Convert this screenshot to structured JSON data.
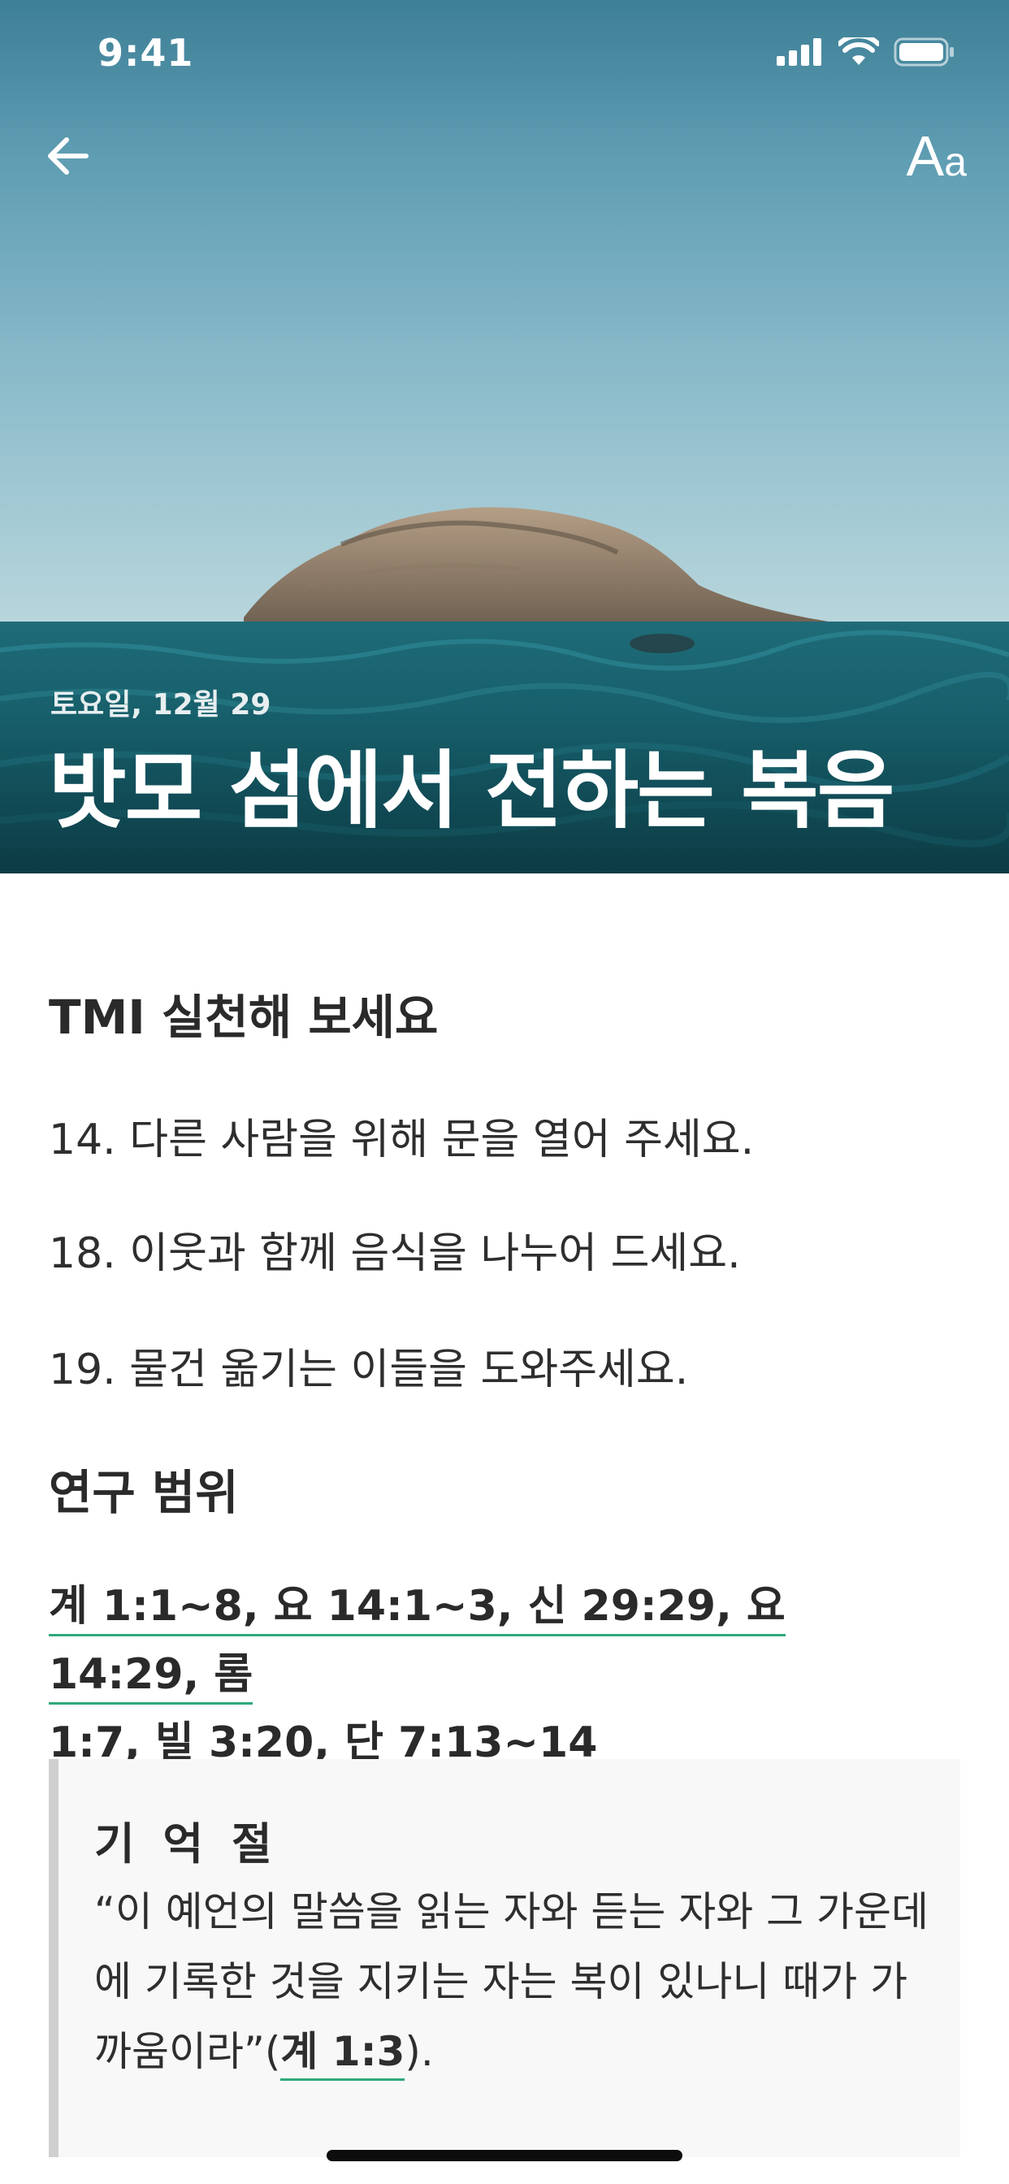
{
  "status_bar": {
    "time": "9:41",
    "icons": [
      "signal-icon",
      "wifi-icon",
      "battery-icon"
    ]
  },
  "nav": {
    "back_icon": "arrow-left-icon",
    "font_size_label_big": "A",
    "font_size_label_small": "a"
  },
  "hero": {
    "date": "토요일, 12월 29",
    "title": "밧모 섬에서 전하는 복음"
  },
  "tmi": {
    "heading": "TMI 실천해 보세요",
    "items": [
      "14. 다른 사람을 위해 문을 열어 주세요.",
      "18. 이웃과 함께 음식을 나누어 드세요.",
      "19. 물건 옮기는 이들을 도와주세요."
    ]
  },
  "study": {
    "heading": "연구 범위",
    "references_line1": "계 1:1~8, 요 14:1~3, 신 29:29, 요 14:29, 롬",
    "references_line2": "1:7, 빌 3:20, 단 7:13~14"
  },
  "memory_verse": {
    "title": "기 억 절",
    "text": "“이 예언의 말씀을 읽는 자와 듣는 자와 그 가운데에 기록한 것을 지키는 자는 복이 있나니 때가 가까움이라”(",
    "reference": "계 1:3",
    "closing": ")."
  },
  "colors": {
    "accent_underline": "#2ea97a",
    "quote_border": "#cfcfcf",
    "quote_background": "#f8f8f8"
  }
}
